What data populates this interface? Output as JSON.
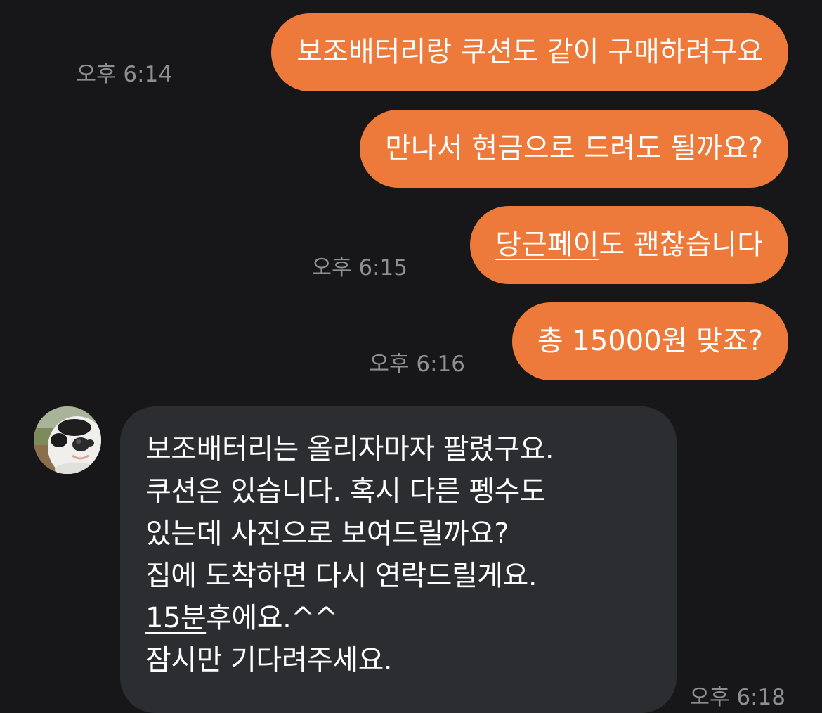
{
  "messages": [
    {
      "side": "out",
      "text": "보조배터리랑 쿠션도 같이 구매하려구요",
      "time": "오후 6:14"
    },
    {
      "side": "out",
      "text": "만나서 현금으로 드려도 될까요?",
      "time": ""
    },
    {
      "side": "out",
      "text_link": "당근페이",
      "text_rest": "도 괜찮습니다",
      "time": "오후 6:15"
    },
    {
      "side": "out",
      "text": "총 15000원 맞죠?",
      "time": "오후 6:16"
    },
    {
      "side": "in",
      "lines": [
        "보조배터리는 올리자마자 팔렸구요.",
        "쿠션은 있습니다. 혹시 다른 펭수도",
        "있는데 사진으로 보여드릴까요?",
        "집에 도착하면 다시 연락드릴게요."
      ],
      "line5_link": "15분",
      "line5_rest": "후에요.^^",
      "line6": "잠시만 기다려주세요.",
      "time": "오후 6:18"
    }
  ],
  "colors": {
    "background": "#17171a",
    "outgoing_bubble": "#ed7a3a",
    "incoming_bubble": "#2c2d31",
    "timestamp": "#8e8f93"
  },
  "avatar_icon": "penguin-character-icon"
}
